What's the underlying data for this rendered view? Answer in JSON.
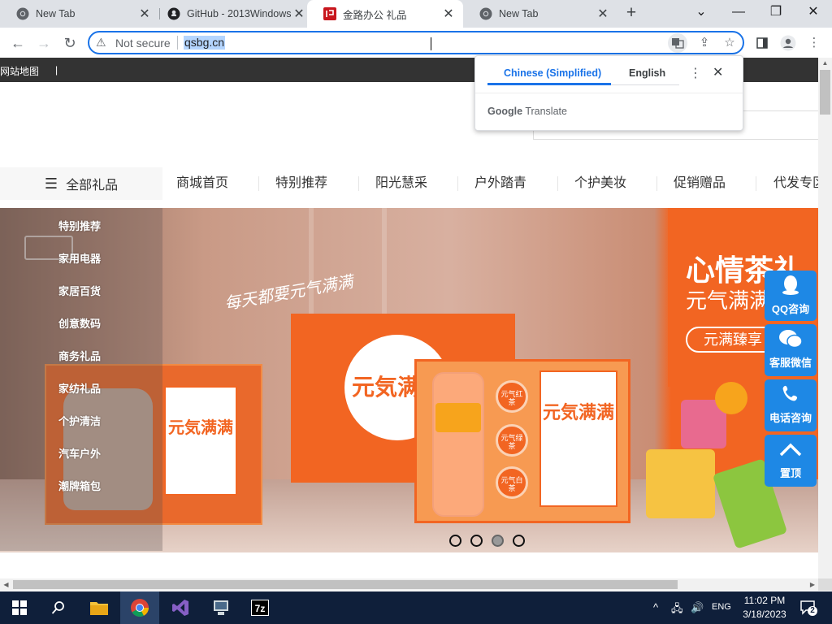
{
  "browser": {
    "tabs": [
      {
        "title": "New Tab",
        "icon": "chrome-icon"
      },
      {
        "title": "GitHub - 2013Windows",
        "icon": "github-icon"
      },
      {
        "title": "金路办公 礼品",
        "icon": "site-favicon"
      },
      {
        "title": "New Tab",
        "icon": "chrome-icon"
      }
    ],
    "close_glyph": "✕",
    "new_tab_glyph": "+",
    "security_label": "Not secure",
    "url": "qsbg.cn",
    "window_controls": {
      "collapse": "⌄",
      "minimize": "—",
      "restore": "❐",
      "close": "✕"
    }
  },
  "translate_popup": {
    "tab_source": "Chinese (Simplified)",
    "tab_target": "English",
    "brand": "Google",
    "product": "Translate"
  },
  "site": {
    "topbar_link": "网站地图",
    "topbar_divider": "|",
    "all_gifts": "全部礼品",
    "nav": [
      "商城首页",
      "特别推荐",
      "阳光慧采",
      "户外踏青",
      "个护美妆",
      "促销赠品",
      "代发专区"
    ],
    "categories": [
      "特别推荐",
      "家用电器",
      "家居百货",
      "创意数码",
      "商务礼品",
      "家纺礼品",
      "个护清洁",
      "汽车户外",
      "潮牌箱包"
    ],
    "banner": {
      "headline": "心情茶礼",
      "subline": "元气满满",
      "pill": "元满臻享",
      "script": "每天都要元气满满",
      "box_title": "元気满满",
      "can_labels": [
        "元气红茶",
        "元气绿茶",
        "元气白茶"
      ],
      "slide_count": 4,
      "active_slide": 3
    },
    "float_bar": [
      {
        "label": "QQ咨询",
        "icon": "qq-icon"
      },
      {
        "label": "客服微信",
        "icon": "wechat-icon"
      },
      {
        "label": "电话咨询",
        "icon": "phone-icon"
      },
      {
        "label": "置顶",
        "icon": "chevron-up-icon"
      }
    ]
  },
  "taskbar": {
    "language": "ENG",
    "time": "11:02 PM",
    "date": "3/18/2023",
    "notification_count": "2"
  },
  "colors": {
    "accent": "#1a73e8",
    "brand_orange": "#f26522",
    "float_blue": "#1e88e5",
    "taskbar": "#0f1f3a"
  }
}
